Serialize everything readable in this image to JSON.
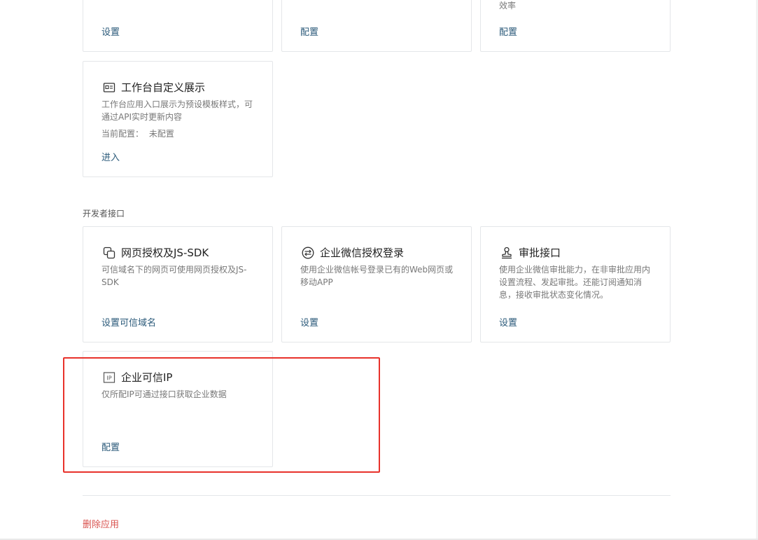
{
  "top_row": {
    "card1": {
      "action": "设置"
    },
    "card2": {
      "action": "配置"
    },
    "card3": {
      "desc_tail": "效率",
      "action": "配置"
    }
  },
  "workbench_card": {
    "title": "工作台自定义展示",
    "desc": "工作台应用入口展示为预设模板样式，可通过API实时更新内容",
    "config_label": "当前配置：",
    "config_value": "未配置",
    "action": "进入",
    "icon": "display-card-icon"
  },
  "dev_section": {
    "label": "开发者接口",
    "cards": [
      {
        "title": "网页授权及JS-SDK",
        "desc": "可信域名下的网页可使用网页授权及JS-SDK",
        "action": "设置可信域名",
        "icon": "copy-pages-icon"
      },
      {
        "title": "企业微信授权登录",
        "desc": "使用企业微信帐号登录已有的Web网页或移动APP",
        "action": "设置",
        "icon": "exchange-arrows-icon"
      },
      {
        "title": "审批接口",
        "desc": "使用企业微信审批能力，在非审批应用内设置流程、发起审批。还能订阅通知消息，接收审批状态变化情况。",
        "action": "设置",
        "icon": "stamp-icon"
      },
      {
        "title": "企业可信IP",
        "desc": "仅所配IP可通过接口获取企业数据",
        "action": "配置",
        "icon": "ip-badge-icon"
      }
    ]
  },
  "footer": {
    "delete_label": "删除应用"
  },
  "colors": {
    "link": "#2b5a7a",
    "danger": "#d9534f",
    "highlight": "#e8322b",
    "border": "#e4e6e9"
  }
}
